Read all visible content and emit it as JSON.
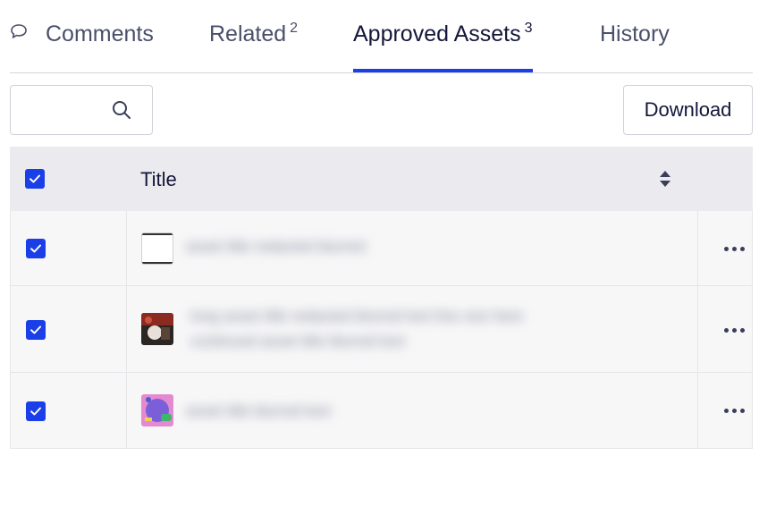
{
  "tabs": [
    {
      "label": "Comments",
      "count": "",
      "icon": "comment-icon",
      "active": false
    },
    {
      "label": "Related",
      "count": "2",
      "active": false
    },
    {
      "label": "Approved Assets",
      "count": "3",
      "active": true
    },
    {
      "label": "History",
      "count": "",
      "active": false
    }
  ],
  "toolbar": {
    "search_value": "",
    "search_placeholder": "",
    "search_icon": "search-icon",
    "download_label": "Download"
  },
  "table": {
    "header": {
      "title": "Title",
      "select_all_checked": true,
      "sort_icon": "sort-icon"
    },
    "rows": [
      {
        "checked": true,
        "thumbnail": "document-thumbnail",
        "title": "asset title redacted blurred"
      },
      {
        "checked": true,
        "thumbnail": "photo-thumbnail",
        "title": "long asset title redacted blurred text line one here",
        "title_line2": "continued asset title blurred text"
      },
      {
        "checked": true,
        "thumbnail": "illustration-thumbnail",
        "title": "asset title blurred text"
      }
    ]
  },
  "colors": {
    "accent": "#1a3ee8",
    "header_bg": "#ebebef",
    "row_bg": "#f7f7f8",
    "text": "#14163a"
  }
}
